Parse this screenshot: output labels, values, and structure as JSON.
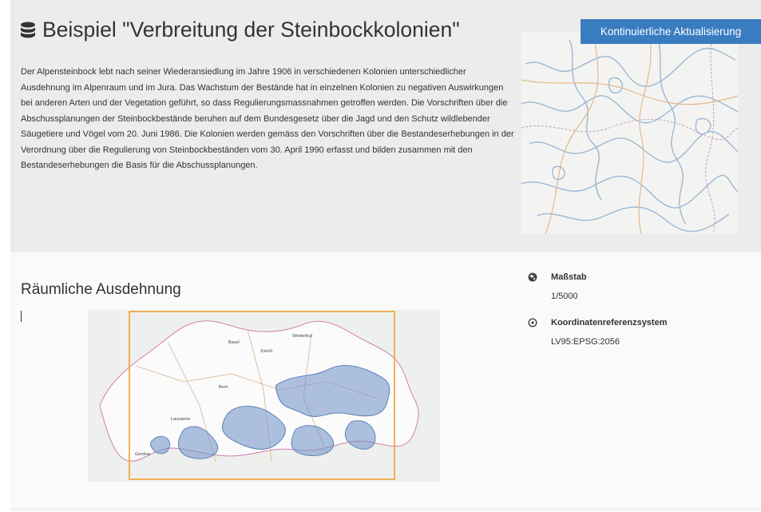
{
  "header": {
    "title": "Beispiel \"Verbreitung der Steinbockkolonien\"",
    "title_icon": "database-icon",
    "description": "Der Alpensteinbock lebt nach seiner Wiederansiedlung im Jahre 1906 in verschiedenen Kolonien unterschiedlicher Ausdehnung im Alpenraum und im Jura. Das Wachstum der Bestände hat in einzelnen Kolonien zu negativen Auswirkungen bei anderen Arten und der Vegetation geführt, so dass Regulierungsmassnahmen getroffen werden. Die Vorschriften über die Abschussplanungen der Steinbockbestände beruhen auf dem Bundesgesetz über die Jagd und den Schutz wildlebender Säugetiere und Vögel vom 20. Juni 1986. Die Kolonien werden gemäss den Vorschriften über die Bestandeserhebungen in der Verordnung über die Regulierung von Steinbockbeständen vom 30. April 1990 erfasst und bilden zusammen mit den Bestandeserhebungen die Basis für die Abschussplanungen.",
    "update_badge": "Kontinuierliche Aktualisierung"
  },
  "extent": {
    "title": "Räumliche Ausdehnung",
    "cities": [
      "Basel",
      "Winterthur",
      "Zürich",
      "Bern",
      "Lausanne",
      "Genève"
    ]
  },
  "metadata": [
    {
      "icon": "globe-icon",
      "label": "Maßstab",
      "value": "1/5000"
    },
    {
      "icon": "target-icon",
      "label": "Koordinatenreferenzsystem",
      "value": "LV95:EPSG:2056"
    }
  ],
  "colors": {
    "accent": "#3a7cc0",
    "header_bg": "#ececec",
    "extent_border": "#f0a030",
    "colony_fill": "#6b8fc6"
  }
}
